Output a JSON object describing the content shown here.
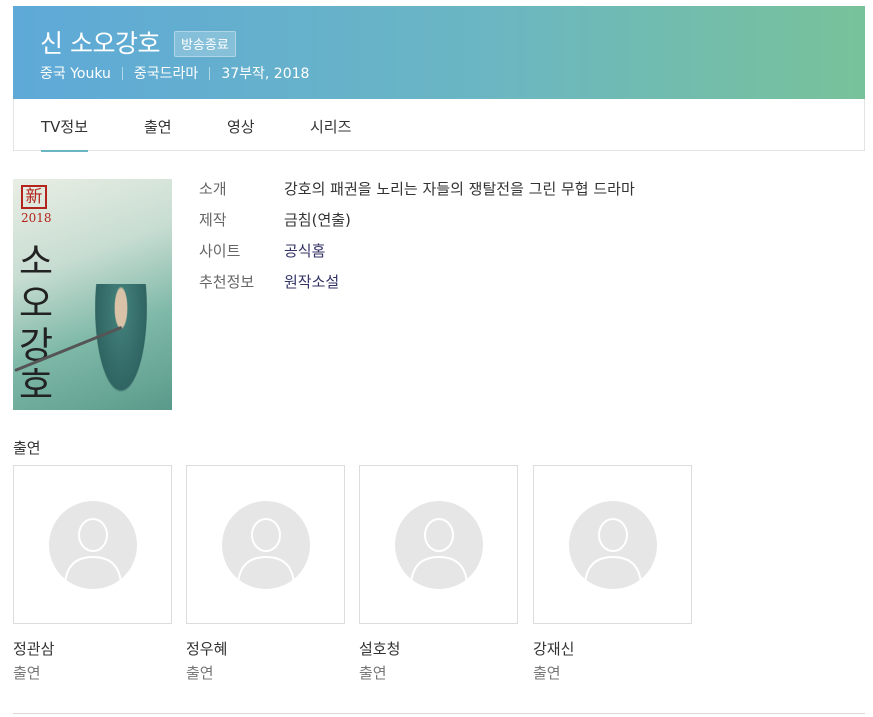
{
  "header": {
    "title": "신 소오강호",
    "status_badge": "방송종료",
    "meta": [
      "중국 Youku",
      "중국드라마",
      "37부작, 2018"
    ]
  },
  "tabs": [
    {
      "label": "TV정보",
      "active": true
    },
    {
      "label": "출연",
      "active": false
    },
    {
      "label": "영상",
      "active": false
    },
    {
      "label": "시리즈",
      "active": false
    }
  ],
  "poster": {
    "seal": "新",
    "year": "2018",
    "title_chars": [
      "소",
      "오",
      "강",
      "호"
    ]
  },
  "info": [
    {
      "label": "소개",
      "value": "강호의 패권을 노리는 자들의 쟁탈전을 그린 무협 드라마",
      "link": false
    },
    {
      "label": "제작",
      "value": "금침(연출)",
      "link": false
    },
    {
      "label": "사이트",
      "value": "공식홈",
      "link": true
    },
    {
      "label": "추천정보",
      "value": "원작소설",
      "link": true
    }
  ],
  "cast_section": {
    "title": "출연"
  },
  "cast": [
    {
      "name": "정관삼",
      "role": "출연"
    },
    {
      "name": "정우혜",
      "role": "출연"
    },
    {
      "name": "설호청",
      "role": "출연"
    },
    {
      "name": "강재신",
      "role": "출연"
    }
  ],
  "colors": {
    "header_gradient_start": "#5ea9d8",
    "header_gradient_end": "#78c29a",
    "tab_active_underline": "#6bb6c3",
    "link": "#333366"
  }
}
